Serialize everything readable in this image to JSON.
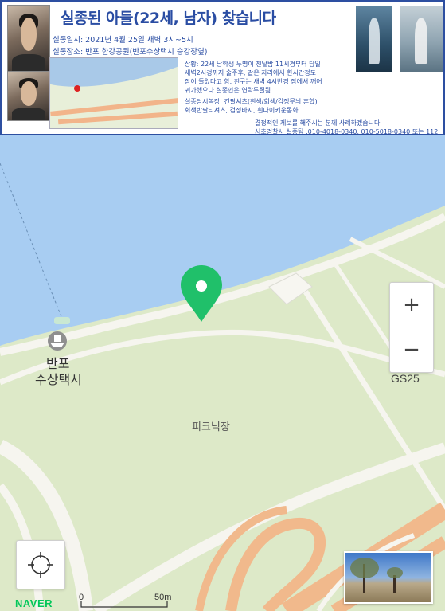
{
  "poster": {
    "title": "실종된 아들(22세, 남자) 찾습니다",
    "date_line": "실종일시: 2021년 4월 25일 새벽 3시~5시",
    "place_line": "실종장소: 반포 한강공원(반포수상택시 승강장옆)",
    "details": [
      "상황: 22세 남학생 두명이 전날밤 11시경부터 당일",
      "새벽2시경까지 술주후, 같은 자리에서 한시간정도",
      "잠이 들었다고 함. 친구는 새벽 4시반경 잠에서 깨어",
      "귀가했으나 실종인은 연락두절됨"
    ],
    "clothing": [
      "실종당시복장: 긴팔셔츠(흰색/회색/검정무늬 혼합)",
      "회색반팔티셔츠, 검정바지, 흰나이키운동화"
    ],
    "reward_line": "결정적인 제보를 해주시는 분께 사례하겠습니다",
    "contact_line": "서초경찰서 실종팀 :010-4018-0340, 010-5018-0340 또는 112"
  },
  "map": {
    "place_name_1": "반포",
    "place_name_2": "수상택시",
    "picnic_label": "피크닉장",
    "gs_label": "GS25",
    "scale_zero": "0",
    "scale_distance": "50m",
    "brand": "NAVER",
    "zoom_in": "+",
    "zoom_out": "−",
    "colors": {
      "water": "#a8cdf2",
      "park": "#dde9c8",
      "path": "#f6f5ef",
      "road": "#f1b98c",
      "pin": "#20c06a",
      "brand": "#03c75a"
    }
  }
}
